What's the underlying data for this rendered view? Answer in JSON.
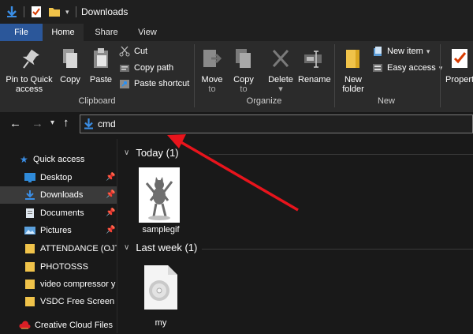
{
  "window": {
    "title": "Downloads"
  },
  "ribbon_tabs": [
    "File",
    "Home",
    "Share",
    "View"
  ],
  "clipboard": {
    "pin_line1": "Pin to Quick",
    "pin_line2": "access",
    "copy": "Copy",
    "paste": "Paste",
    "cut": "Cut",
    "copy_path": "Copy path",
    "paste_shortcut": "Paste shortcut",
    "group": "Clipboard"
  },
  "organize": {
    "move_line1": "Move",
    "move_line2": "to",
    "copy_line1": "Copy",
    "copy_line2": "to",
    "delete": "Delete",
    "rename": "Rename",
    "group": "Organize"
  },
  "new": {
    "folder_line1": "New",
    "folder_line2": "folder",
    "new_item": "New item",
    "easy_access": "Easy access",
    "group": "New"
  },
  "open": {
    "properties": "Propert"
  },
  "address": {
    "value": "cmd"
  },
  "sidebar": {
    "quick_access": "Quick access",
    "items": [
      {
        "label": "Desktop",
        "icon": "desktop-icon",
        "pinned": true
      },
      {
        "label": "Downloads",
        "icon": "download-icon",
        "pinned": true,
        "selected": true
      },
      {
        "label": "Documents",
        "icon": "documents-icon",
        "pinned": true
      },
      {
        "label": "Pictures",
        "icon": "pictures-icon",
        "pinned": true
      },
      {
        "label": "ATTENDANCE (OJT)",
        "icon": "folder-icon"
      },
      {
        "label": "PHOTOSSS",
        "icon": "folder-icon"
      },
      {
        "label": "video compressor y",
        "icon": "folder-icon"
      },
      {
        "label": "VSDC Free Screen R",
        "icon": "folder-icon"
      }
    ],
    "creative_cloud": "Creative Cloud Files"
  },
  "content": {
    "groups": [
      {
        "label": "Today (1)",
        "files": [
          {
            "name": "samplegif",
            "type": "gif-thumbnail"
          }
        ]
      },
      {
        "label": "Last week (1)",
        "files": [
          {
            "name": "my",
            "type": "disc-image-file"
          }
        ]
      }
    ]
  },
  "colors": {
    "accent": "#2b579a",
    "arrow": "#e8141c",
    "folder": "#f0c34a"
  }
}
